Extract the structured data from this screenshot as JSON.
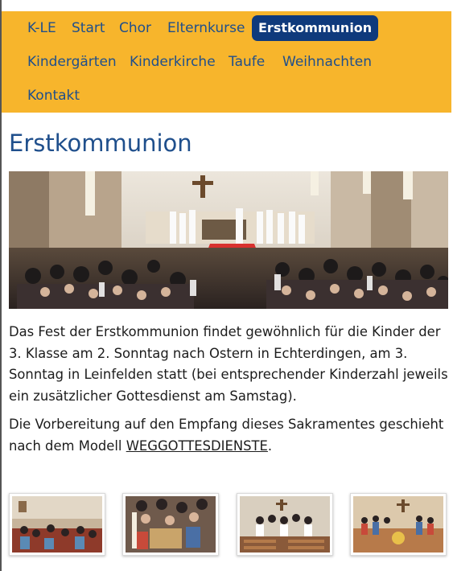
{
  "nav": {
    "items": [
      {
        "label": "K-LE"
      },
      {
        "label": "Start"
      },
      {
        "label": "Chor"
      },
      {
        "label": "Elternkurse"
      },
      {
        "label": "Erstkommunion"
      },
      {
        "label": "Kindergärten"
      },
      {
        "label": "Kinderkirche"
      },
      {
        "label": "Taufe"
      },
      {
        "label": "Weihnachten"
      },
      {
        "label": "Kontakt"
      }
    ],
    "active": "Erstkommunion"
  },
  "page": {
    "title": "Erstkommunion"
  },
  "content": {
    "p1_start": "Das Fest der Erstkommunion findet gewöhnlich für die Kinder der 3. Klasse am 2. Sonntag nach Ostern in Echterdingen, am 3. Sonntag in Leinfelden statt (bei entsprechender Kinderzahl jeweils ein zusätzlicher Gottesdienst am Samstag).",
    "p2_start": "Die Vorbereitung auf den Empfang dieses Sakramentes geschieht nach dem Modell ",
    "p2_link": "WEGGOTTESDIENSTE",
    "p2_end": "."
  },
  "colors": {
    "nav_bg": "#f7b52c",
    "nav_text": "#1f4f8c",
    "nav_active_bg": "#0f3a7c",
    "title": "#1f4f8c"
  },
  "images": {
    "hero": "church-interior-photo",
    "thumbnails": [
      "children-in-church-photo",
      "children-with-candle-photo",
      "group-in-church-photo",
      "children-at-altar-photo"
    ]
  }
}
